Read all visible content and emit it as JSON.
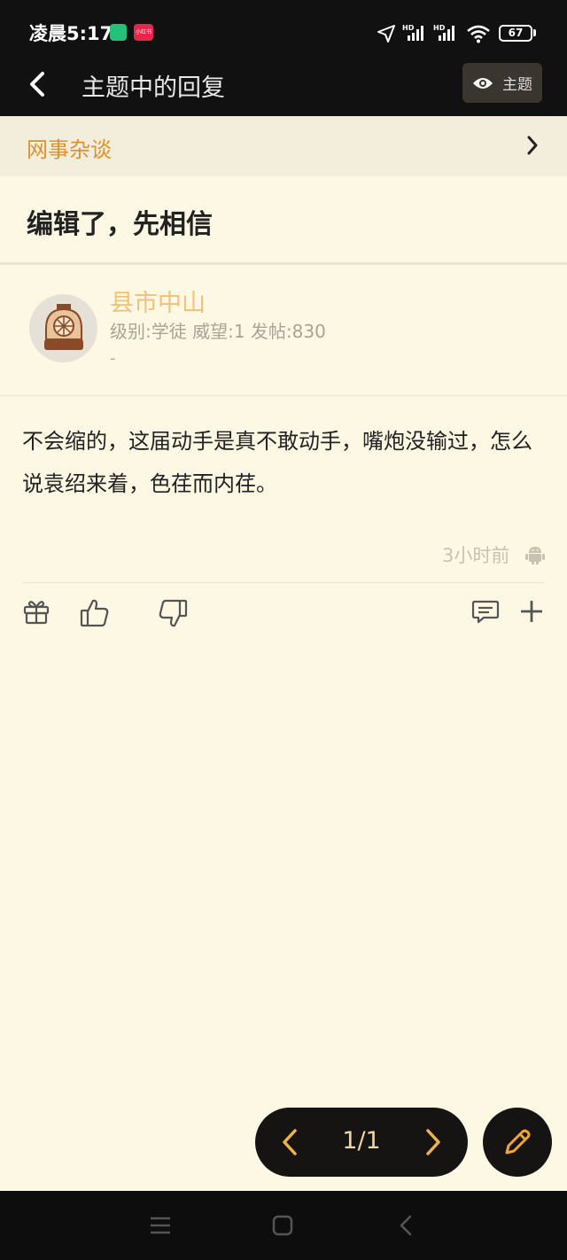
{
  "status_bar": {
    "time": "凌晨5:17",
    "app_badge_2": "小红书",
    "battery": "67"
  },
  "header": {
    "title": "主题中的回复",
    "theme_button": "主题"
  },
  "forum": {
    "name": "网事杂谈"
  },
  "post": {
    "title": "编辑了，先相信",
    "author": {
      "name": "县市中山",
      "meta": "级别:学徒 威望:1 发帖:830",
      "signature": "-"
    },
    "content": "不会缩的，这届动手是真不敢动手，嘴炮没输过，怎么说袁绍来着，色荏而内荏。",
    "time": "3小时前"
  },
  "pager": {
    "page": "1/1"
  },
  "colors": {
    "background": "#fdf8e3",
    "accent": "#e0902c",
    "author_name": "#f0c27b",
    "dark_bar": "#111111"
  }
}
